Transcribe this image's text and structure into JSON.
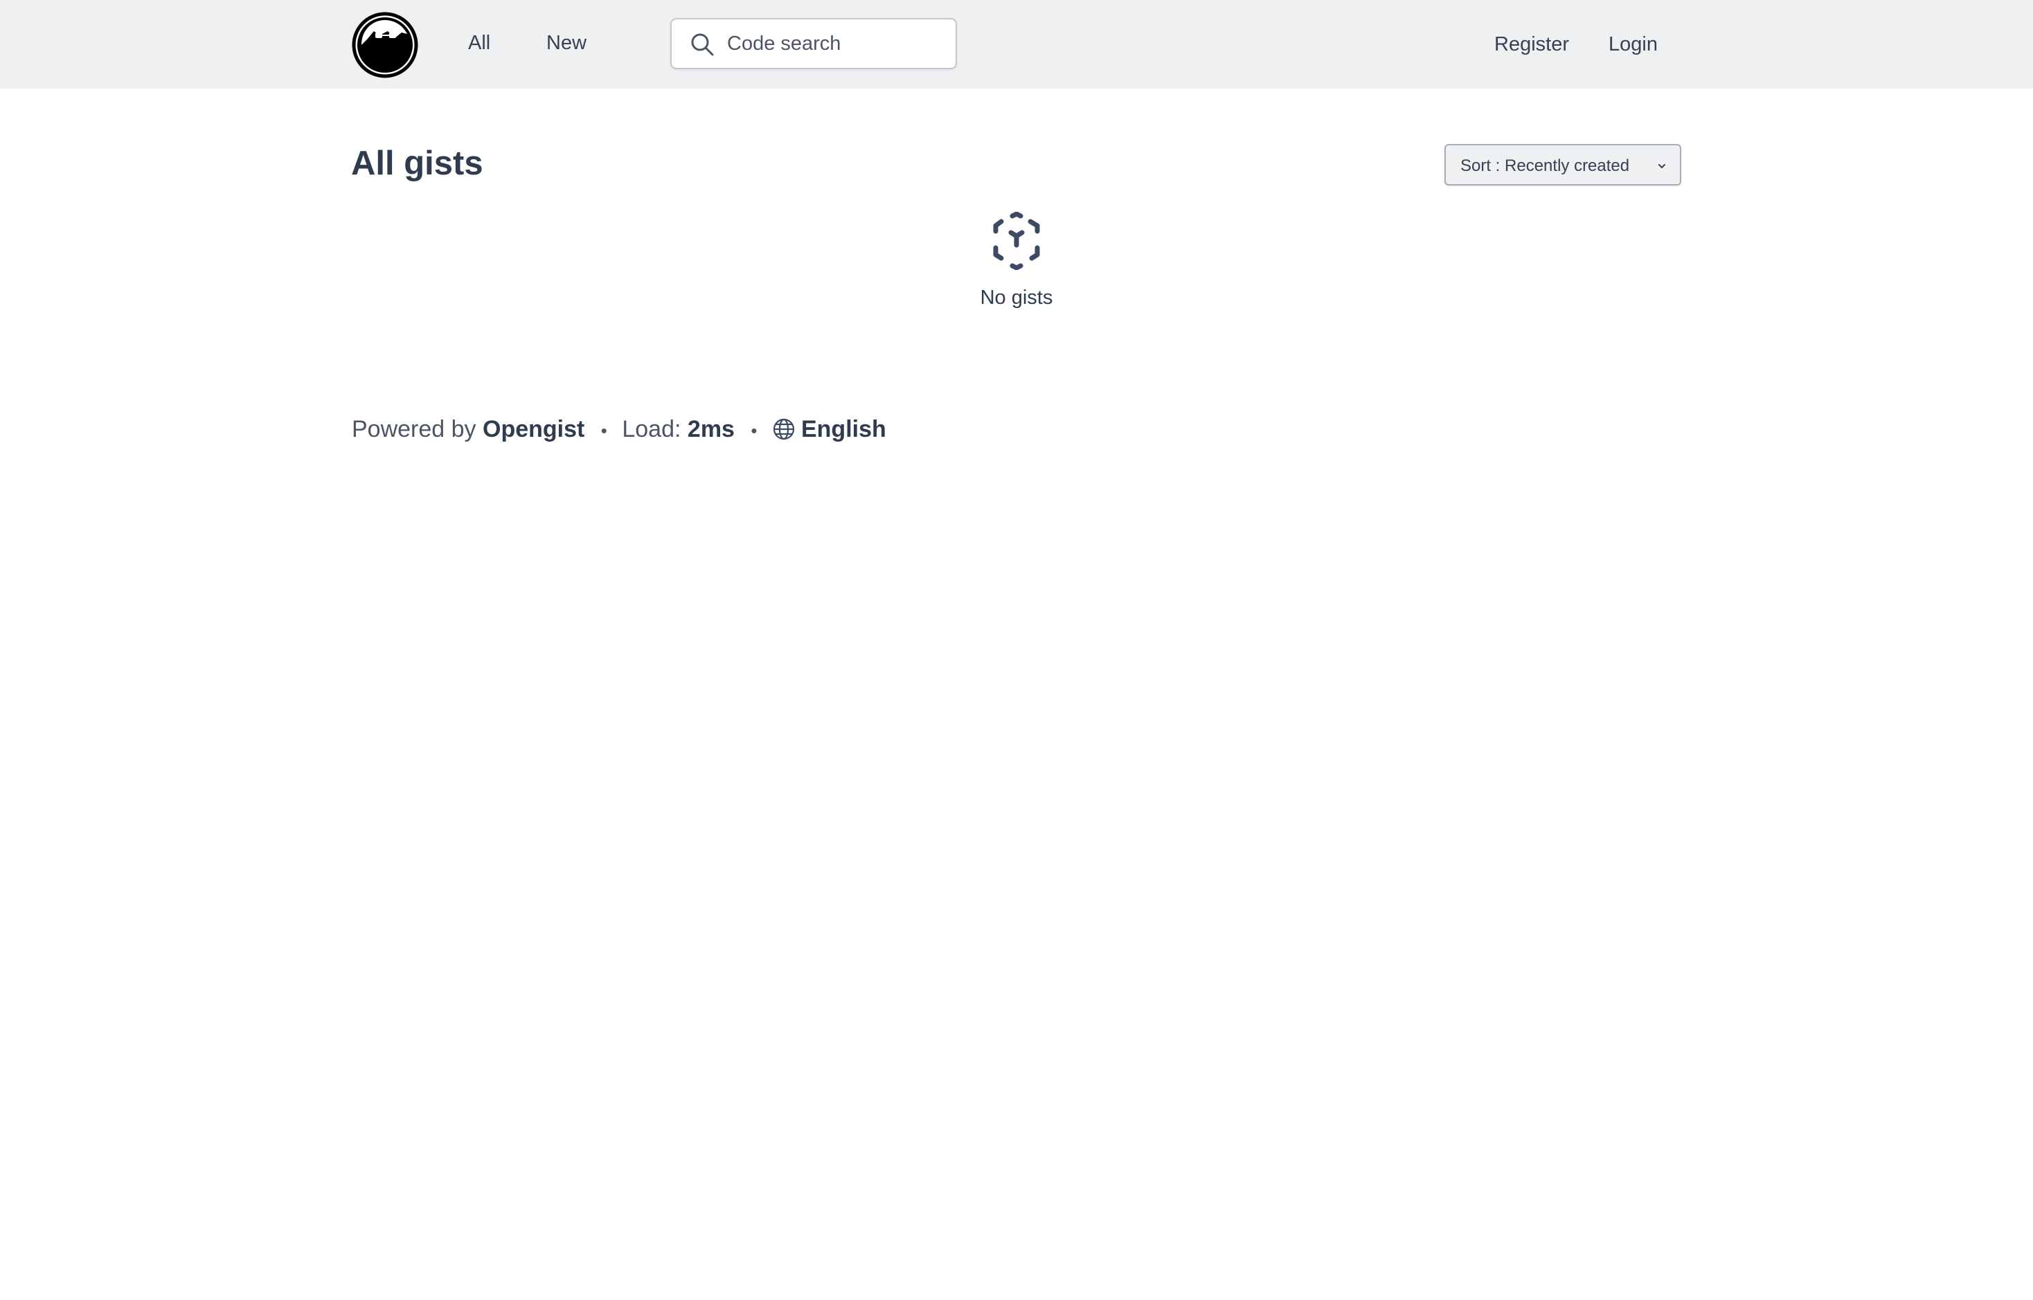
{
  "header": {
    "logo_icon": "opengist-logo-icon",
    "nav": {
      "all": "All",
      "new": "New"
    },
    "search": {
      "placeholder": "Code search",
      "icon": "search-icon"
    },
    "register": "Register",
    "login": "Login"
  },
  "main": {
    "title": "All gists",
    "sort": {
      "label": "Sort : Recently created",
      "icon": "chevron-down-icon"
    },
    "empty_state": {
      "icon": "cube-dashed-icon",
      "text": "No gists"
    }
  },
  "footer": {
    "powered_by_prefix": "Powered by",
    "powered_by_name": "Opengist",
    "separator": "•",
    "load_label": "Load:",
    "load_value": "2ms",
    "language_icon": "globe-icon",
    "language": "English"
  },
  "colors": {
    "header_bg": "#eef0f2",
    "text_dark": "#2f3b4e",
    "text": "#374151"
  }
}
